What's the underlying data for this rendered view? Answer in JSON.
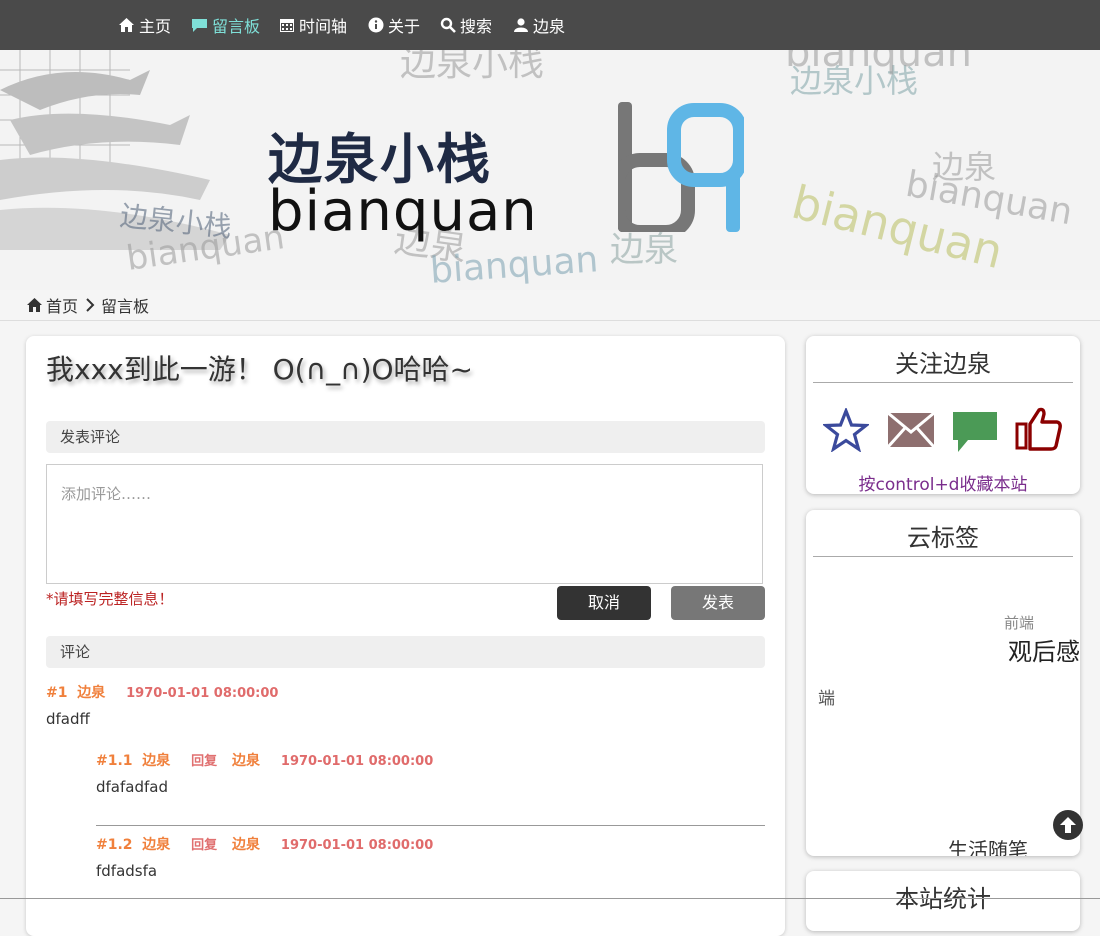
{
  "nav": {
    "items": [
      {
        "label": "主页",
        "icon": "home-icon"
      },
      {
        "label": "留言板",
        "icon": "comment-icon",
        "active": true
      },
      {
        "label": "时间轴",
        "icon": "calendar-icon"
      },
      {
        "label": "关于",
        "icon": "info-icon"
      },
      {
        "label": "搜索",
        "icon": "search-icon"
      },
      {
        "label": "边泉",
        "icon": "user-icon"
      }
    ]
  },
  "banner": {
    "logo_cn": "边泉小栈",
    "logo_en": "bianquan",
    "watermarks": [
      "边泉小栈",
      "bianquan",
      "边泉",
      "bianquan",
      "边泉小栈",
      "bianquan",
      "边泉",
      "bianquan",
      "bianquan",
      "边泉小栈"
    ]
  },
  "breadcrumb": {
    "home": "首页",
    "current": "留言板"
  },
  "main": {
    "title": "我xxx到此一游！ O(∩_∩)O哈哈~",
    "post_comment_label": "发表评论",
    "comment_placeholder": "添加评论……",
    "warning": "*请填写完整信息！",
    "cancel_label": "取消",
    "submit_label": "发表",
    "comments_label": "评论",
    "comments": [
      {
        "num": "#1",
        "author": "边泉",
        "date": "1970-01-01 08:00:00",
        "text": "dfadff",
        "replies": [
          {
            "num": "#1.1",
            "author": "边泉",
            "reply_word": "回复",
            "reply_to": "边泉",
            "date": "1970-01-01 08:00:00",
            "text": "dfafadfad"
          },
          {
            "num": "#1.2",
            "author": "边泉",
            "reply_word": "回复",
            "reply_to": "边泉",
            "date": "1970-01-01 08:00:00",
            "text": "fdfadsfa"
          }
        ]
      }
    ]
  },
  "sidebar": {
    "follow": {
      "title": "关注边泉",
      "icons": [
        "star-icon",
        "mail-icon",
        "chat-icon",
        "thumbs-up-icon"
      ],
      "bookmark_hint": "按control+d收藏本站"
    },
    "tags": {
      "title": "云标签",
      "items": [
        "前端",
        "观后感",
        "端",
        "生活随笔"
      ]
    },
    "stats": {
      "title": "本站统计"
    }
  },
  "colors": {
    "nav_bg": "#4a4a4a",
    "nav_active": "#7fe0d8",
    "meta_orange": "#f0803c",
    "date_red": "#e06b6b",
    "hint_purple": "#7a2d8c"
  }
}
